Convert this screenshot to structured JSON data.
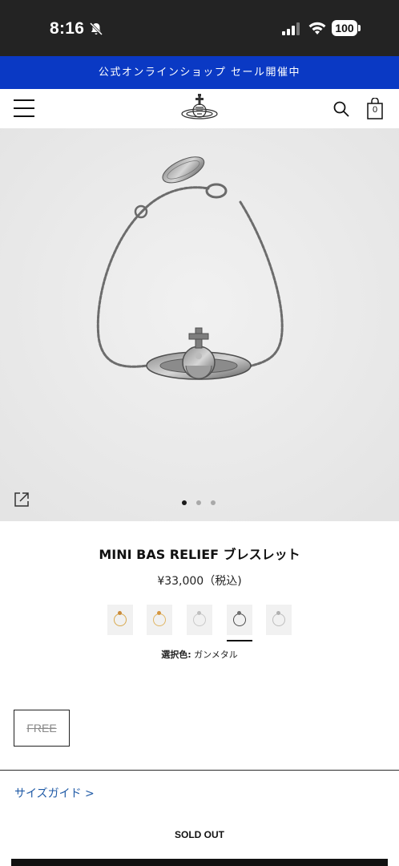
{
  "status_bar": {
    "time": "8:16",
    "battery": "100"
  },
  "banner": {
    "text": "公式オンラインショップ セール開催中"
  },
  "header": {
    "cart_count": "0"
  },
  "carousel": {
    "total": 3,
    "active_index": 0
  },
  "product": {
    "title": "MINI BAS RELIEF ブレスレット",
    "price": "¥33,000（税込)",
    "selected_color_label": "選択色:",
    "selected_color_value": "ガンメタル",
    "size_option": "FREE",
    "size_guide": "サイズガイド >",
    "status": "SOLD OUT"
  },
  "swatches": [
    {
      "metal": "#d8a94d",
      "gem": "#c98a3a"
    },
    {
      "metal": "#e0b664",
      "gem": "#d4953f"
    },
    {
      "metal": "#c9c9c9",
      "gem": "#bfbfbf"
    },
    {
      "metal": "#4d4d4d",
      "gem": "#6f6f6f",
      "selected": true
    },
    {
      "metal": "#bdbdbd",
      "gem": "#b0b0b0"
    }
  ],
  "colors": {
    "banner": "#0a39c4",
    "link": "#1f5aa6"
  },
  "icons": [
    "bell-slash-icon",
    "signal-icon",
    "wifi-icon",
    "battery-icon",
    "menu-icon",
    "logo-icon",
    "search-icon",
    "shopping-bag-icon",
    "expand-icon"
  ]
}
